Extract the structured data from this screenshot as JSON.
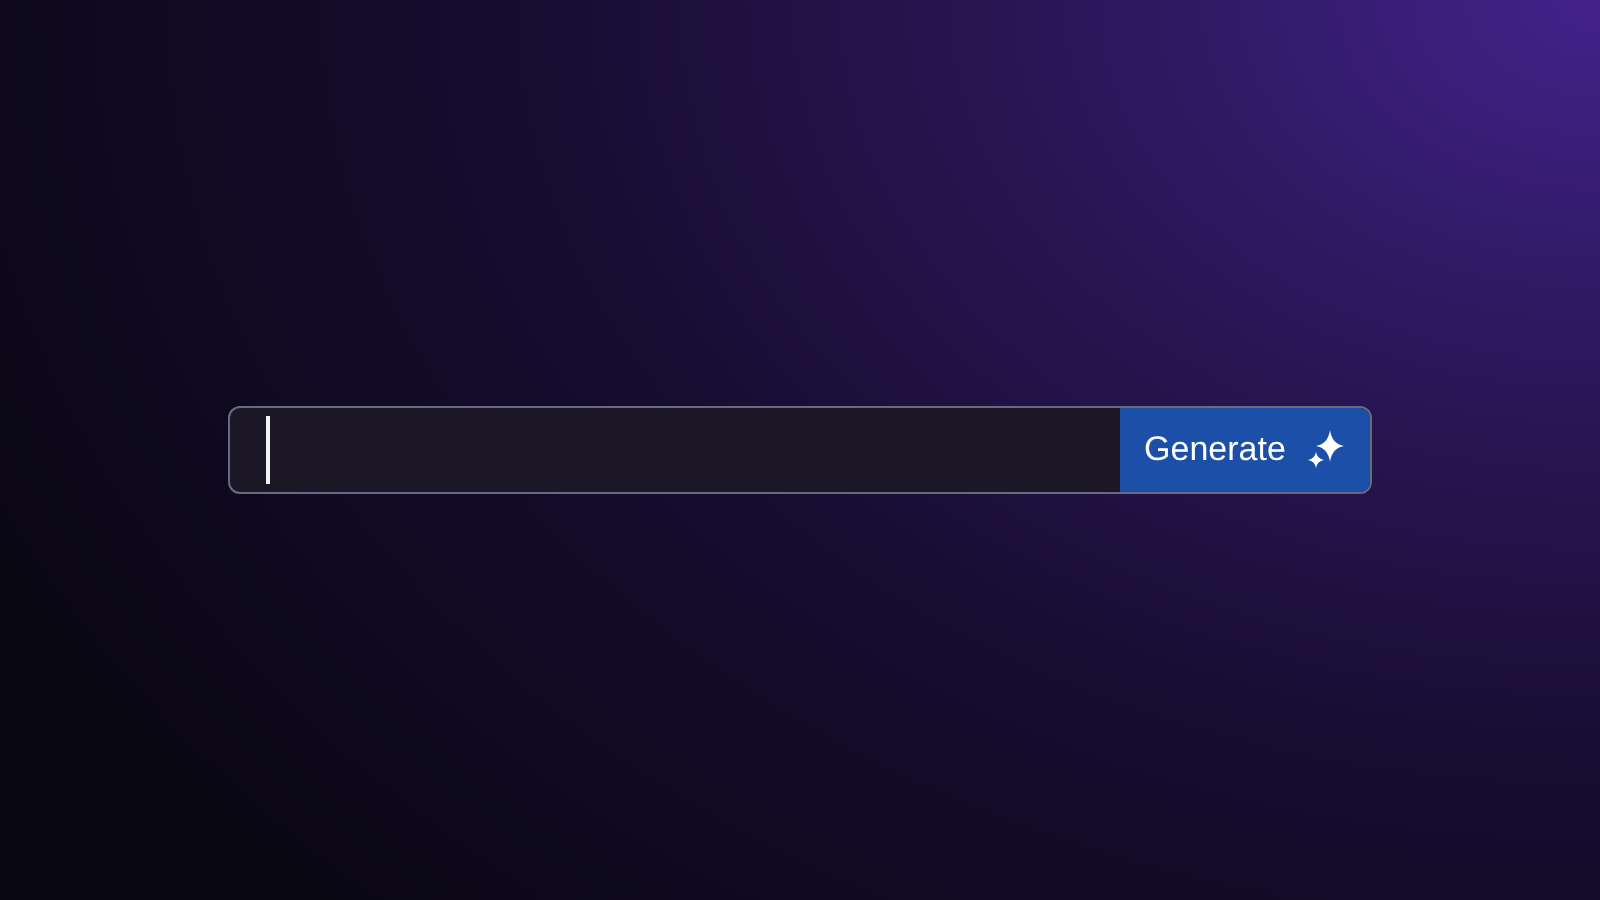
{
  "prompt_bar": {
    "button": {
      "label": "Generate"
    }
  }
}
